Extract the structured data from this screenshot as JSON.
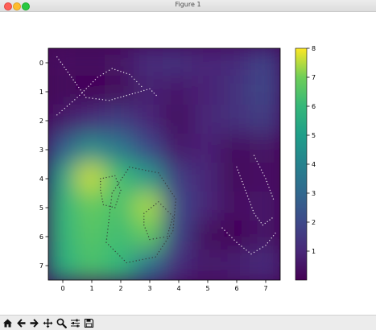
{
  "window": {
    "title": "Figure 1"
  },
  "toolbar": {
    "buttons": [
      {
        "name": "home-icon"
      },
      {
        "name": "back-arrow-icon"
      },
      {
        "name": "forward-arrow-icon"
      },
      {
        "name": "pan-icon"
      },
      {
        "name": "zoom-icon"
      },
      {
        "name": "subplots-config-icon"
      },
      {
        "name": "save-icon"
      }
    ]
  },
  "chart_data": {
    "type": "heatmap",
    "colormap": "viridis",
    "title": "",
    "xlabel": "",
    "ylabel": "",
    "xlim": [
      -0.5,
      7.5
    ],
    "ylim": [
      7.5,
      -0.5
    ],
    "xticks": [
      "0",
      "1",
      "2",
      "3",
      "4",
      "5",
      "6",
      "7"
    ],
    "yticks": [
      "0",
      "1",
      "2",
      "3",
      "4",
      "5",
      "6",
      "7"
    ],
    "colorbar": {
      "range": [
        0,
        8
      ],
      "ticks": [
        "1",
        "2",
        "3",
        "4",
        "5",
        "6",
        "7",
        "8"
      ]
    },
    "rows": [
      0,
      1,
      2,
      3,
      4,
      5,
      6,
      7
    ],
    "columns": [
      0,
      1,
      2,
      3,
      4,
      5,
      6,
      7
    ],
    "values": [
      [
        0.4,
        0.3,
        0.5,
        1.2,
        1.3,
        1.0,
        1.1,
        1.8
      ],
      [
        0.2,
        0.1,
        0.2,
        0.8,
        0.6,
        0.9,
        1.3,
        1.9
      ],
      [
        0.6,
        1.2,
        1.6,
        1.0,
        0.3,
        1.0,
        1.3,
        1.6
      ],
      [
        2.6,
        4.4,
        3.6,
        2.0,
        0.6,
        0.9,
        0.3,
        0.5
      ],
      [
        5.2,
        7.6,
        6.2,
        4.8,
        1.6,
        1.0,
        0.2,
        0.4
      ],
      [
        5.8,
        6.8,
        6.4,
        7.4,
        2.0,
        1.0,
        0.4,
        0.6
      ],
      [
        5.8,
        6.6,
        6.2,
        6.8,
        1.8,
        0.3,
        0.1,
        0.5
      ],
      [
        5.6,
        6.4,
        6.0,
        3.4,
        1.2,
        0.6,
        0.8,
        1.2
      ]
    ]
  }
}
